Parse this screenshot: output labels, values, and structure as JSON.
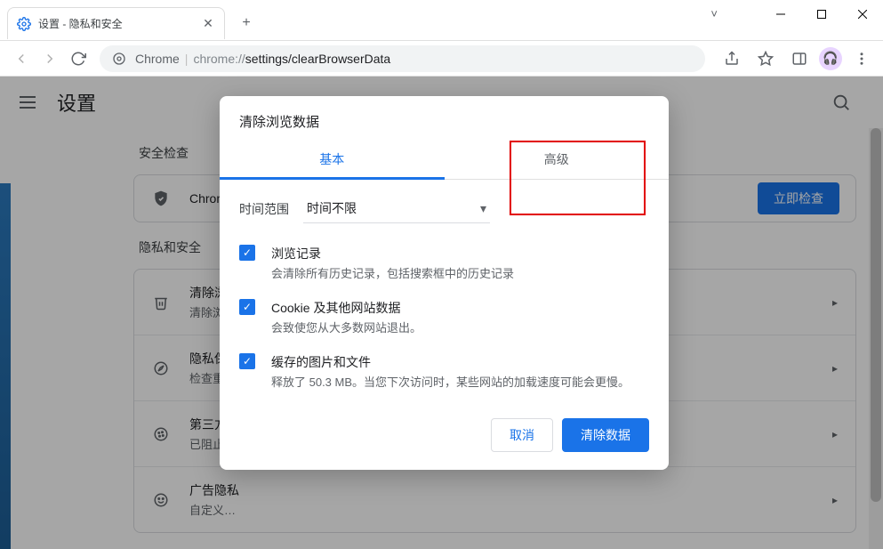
{
  "window": {
    "tab_title": "设置 - 隐私和安全",
    "caret": "˅"
  },
  "omnibox": {
    "chrome_label": "Chrome",
    "url_prefix": "chrome://",
    "url_rest": "settings/clearBrowserData"
  },
  "settings": {
    "title": "设置"
  },
  "sections": {
    "safety_label": "安全检查",
    "safety_row_text": "Chrome",
    "safety_button": "立即检查",
    "privacy_label": "隐私和安全",
    "rows": [
      {
        "title": "清除浏览数据",
        "sub": "清除浏览…"
      },
      {
        "title": "隐私保护",
        "sub": "检查重…"
      },
      {
        "title": "第三方…",
        "sub": "已阻止…"
      },
      {
        "title": "广告隐私",
        "sub": "自定义…"
      }
    ]
  },
  "dialog": {
    "title": "清除浏览数据",
    "tabs": {
      "basic": "基本",
      "advanced": "高级"
    },
    "time_label": "时间范围",
    "time_value": "时间不限",
    "items": [
      {
        "title": "浏览记录",
        "sub": "会清除所有历史记录，包括搜索框中的历史记录"
      },
      {
        "title": "Cookie 及其他网站数据",
        "sub": "会致使您从大多数网站退出。"
      },
      {
        "title": "缓存的图片和文件",
        "sub": "释放了 50.3 MB。当您下次访问时，某些网站的加载速度可能会更慢。"
      }
    ],
    "cancel": "取消",
    "confirm": "清除数据"
  },
  "colors": {
    "accent": "#1a73e8",
    "annotation": "#e20000"
  }
}
